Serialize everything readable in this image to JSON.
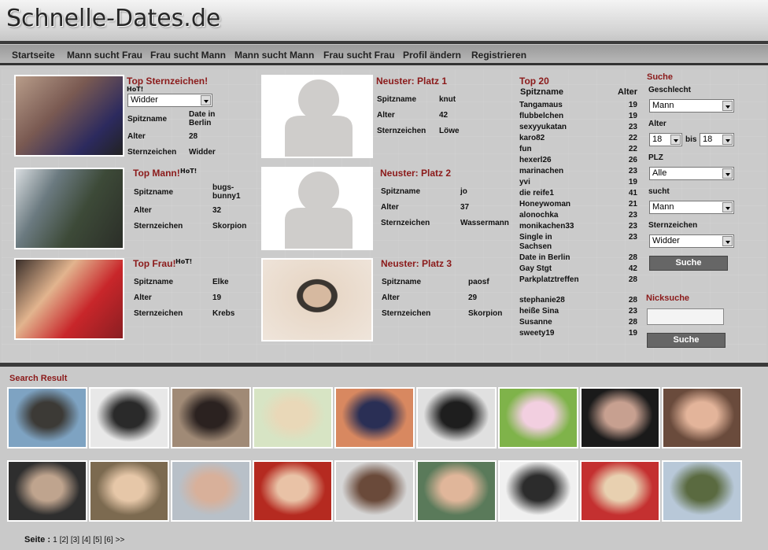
{
  "header": {
    "logo": "Schnelle-Dates.de"
  },
  "nav": [
    "Startseite",
    "Mann sucht Frau",
    "Frau sucht Mann",
    "Mann sucht Mann",
    "Frau sucht Frau",
    "Profil ändern",
    "Registrieren"
  ],
  "labels": {
    "spitzname": "Spitzname",
    "alter": "Alter",
    "sternzeichen": "Sternzeichen",
    "hot": "HoT!"
  },
  "top_sternzeichen": {
    "title": "Top Sternzeichen!",
    "select": "Widder",
    "spitzname": "Date in Berlin",
    "alter": "28",
    "sternzeichen": "Widder"
  },
  "top_mann": {
    "title": "Top Mann!",
    "spitzname": "bugs-bunny1",
    "alter": "32",
    "sternzeichen": "Skorpion"
  },
  "top_frau": {
    "title": "Top Frau!",
    "spitzname": "Elke",
    "alter": "19",
    "sternzeichen": "Krebs"
  },
  "neuster1": {
    "title": "Neuster: Platz 1",
    "spitzname": "knut",
    "alter": "42",
    "sternzeichen": "Löwe"
  },
  "neuster2": {
    "title": "Neuster: Platz 2",
    "spitzname": "jo",
    "alter": "37",
    "sternzeichen": "Wassermann"
  },
  "neuster3": {
    "title": "Neuster: Platz 3",
    "spitzname": "paosf",
    "alter": "29",
    "sternzeichen": "Skorpion"
  },
  "top20": {
    "title": "Top 20",
    "col_name": "Spitzname",
    "col_age": "Alter",
    "rows": [
      {
        "name": "Tangamaus",
        "age": "19"
      },
      {
        "name": "flubbelchen",
        "age": "19"
      },
      {
        "name": "sexyyukatan",
        "age": "23"
      },
      {
        "name": "karo82",
        "age": "22"
      },
      {
        "name": "fun",
        "age": "22"
      },
      {
        "name": "hexerl26",
        "age": "26"
      },
      {
        "name": "marinachen",
        "age": "23"
      },
      {
        "name": "yvi",
        "age": "19"
      },
      {
        "name": "die reife1",
        "age": "41"
      },
      {
        "name": "Honeywoman",
        "age": "21"
      },
      {
        "name": "alonochka",
        "age": "23"
      },
      {
        "name": "monikachen33",
        "age": "23"
      },
      {
        "name": "Single in Sachsen",
        "age": "23"
      },
      {
        "name": "Date in Berlin",
        "age": "28"
      },
      {
        "name": "Gay Stgt",
        "age": "42"
      },
      {
        "name": "Parkplatztreffen",
        "age": "28"
      },
      {
        "name": "stephanie28",
        "age": "28"
      },
      {
        "name": "heiße Sina",
        "age": "23"
      },
      {
        "name": "Susanne",
        "age": "28"
      },
      {
        "name": "sweety19",
        "age": "19"
      }
    ]
  },
  "suche": {
    "title": "Suche",
    "geschlecht_label": "Geschlecht",
    "geschlecht": "Mann",
    "alter_label": "Alter",
    "alter_von": "18",
    "bis": "bis",
    "alter_bis": "18",
    "plz_label": "PLZ",
    "plz": "Alle",
    "sucht_label": "sucht",
    "sucht": "Mann",
    "sternzeichen_label": "Sternzeichen",
    "sternzeichen": "Widder",
    "button": "Suche"
  },
  "nicksuche": {
    "title": "Nicksuche",
    "value": "",
    "button": "Suche"
  },
  "search_result": {
    "title": "Search Result"
  },
  "pagination": {
    "label": "Seite :",
    "current": "1",
    "pages": [
      "[2]",
      "[3]",
      "[4]",
      "[5]",
      "[6]"
    ],
    "next": ">>"
  },
  "colors": {
    "accent_red": "#8b1a1a",
    "nav_text": "#222222",
    "button": "#666666"
  }
}
